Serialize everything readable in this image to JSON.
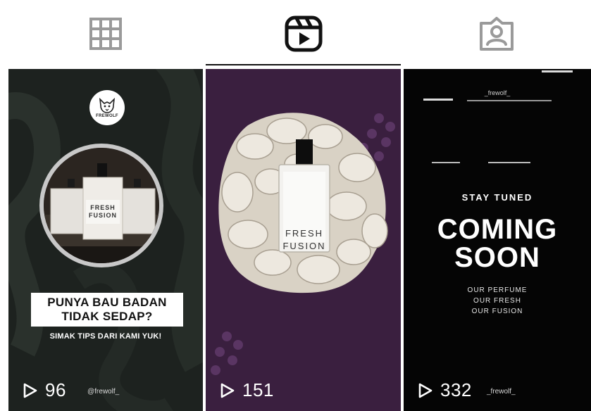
{
  "tabs": [
    {
      "name": "grid-icon",
      "active": false
    },
    {
      "name": "reels-icon",
      "active": true
    },
    {
      "name": "tagged-icon",
      "active": false
    }
  ],
  "tiles": [
    {
      "brand": "FREWOLF",
      "headline_line1": "PUNYA BAU BADAN",
      "headline_line2": "TIDAK SEDAP?",
      "subline": "SIMAK TIPS DARI KAMI YUK!",
      "bottle_label": "FRESH FUSION",
      "plays": "96",
      "handle": "@frewolf_"
    },
    {
      "bottle_label_line1": "FRESH",
      "bottle_label_line2": "FUSION",
      "plays": "151"
    },
    {
      "handle_top": "_frewolf_",
      "stay_tuned": "STAY TUNED",
      "big_line1": "COMING",
      "big_line2": "SOON",
      "tagline1": "OUR PERFUME",
      "tagline2": "OUR FRESH",
      "tagline3": "OUR FUSION",
      "plays": "332",
      "handle": "_frewolf_"
    }
  ],
  "colors": {
    "indicator": "#111111",
    "icon_inactive": "#9a9a9a",
    "icon_active": "#111111"
  }
}
